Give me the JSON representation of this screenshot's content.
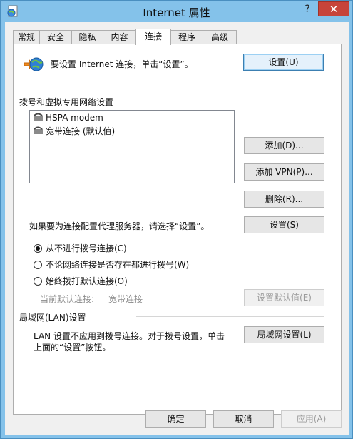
{
  "window": {
    "title": "Internet 属性",
    "help": "?",
    "close": "✕"
  },
  "tabs": [
    {
      "label": "常规"
    },
    {
      "label": "安全"
    },
    {
      "label": "隐私"
    },
    {
      "label": "内容"
    },
    {
      "label": "连接",
      "active": true
    },
    {
      "label": "程序"
    },
    {
      "label": "高级"
    }
  ],
  "setup": {
    "text": "要设置 Internet 连接，单击“设置”。",
    "button": "设置(U)"
  },
  "dialup": {
    "group_label": "拨号和虚拟专用网络设置",
    "items": [
      "HSPA modem",
      "宽带连接 (默认值)"
    ],
    "add": "添加(D)...",
    "add_vpn": "添加 VPN(P)...",
    "delete": "删除(R)...",
    "proxy_text": "如果要为连接配置代理服务器，请选择“设置”。",
    "settings": "设置(S)",
    "radios": [
      {
        "label": "从不进行拨号连接(C)",
        "checked": true
      },
      {
        "label": "不论网络连接是否存在都进行拨号(W)",
        "checked": false
      },
      {
        "label": "始终拨打默认连接(O)",
        "checked": false
      }
    ],
    "current_default_label": "当前默认连接:",
    "current_default_value": "宽带连接",
    "set_default": "设置默认值(E)"
  },
  "lan": {
    "group_label": "局域网(LAN)设置",
    "text_line1": "LAN 设置不应用到拨号连接。对于拨号设置，单击",
    "text_line2": "上面的“设置”按钮。",
    "button": "局域网设置(L)"
  },
  "footer": {
    "ok": "确定",
    "cancel": "取消",
    "apply": "应用(A)"
  },
  "colors": {
    "titlebar": "#84c2ea",
    "close": "#c7443a",
    "panel": "#ffffff",
    "client": "#f0f0f0"
  }
}
